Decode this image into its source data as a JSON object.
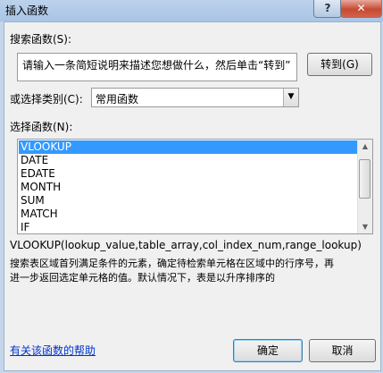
{
  "window": {
    "title": "插入函数",
    "help_label": "?",
    "close_label": "✕"
  },
  "search": {
    "label": "搜索函数(S):",
    "value": "请输入一条简短说明来描述您想做什么，然后单击“转到”",
    "go_label": "转到(G)"
  },
  "category": {
    "label": "或选择类别(C):",
    "value": "常用函数"
  },
  "functions": {
    "label": "选择函数(N):",
    "items": [
      "VLOOKUP",
      "DATE",
      "EDATE",
      "MONTH",
      "SUM",
      "MATCH",
      "IF"
    ],
    "selected": "VLOOKUP"
  },
  "details": {
    "signature": "VLOOKUP(lookup_value,table_array,col_index_num,range_lookup)",
    "description_line1": "搜索表区域首列满足条件的元素，确定待检索单元格在区域中的行序号，再",
    "description_line2": "进一步返回选定单元格的值。默认情况下，表是以升序排序的"
  },
  "footer": {
    "help_link": "有关该函数的帮助",
    "ok_label": "确定",
    "cancel_label": "取消"
  }
}
